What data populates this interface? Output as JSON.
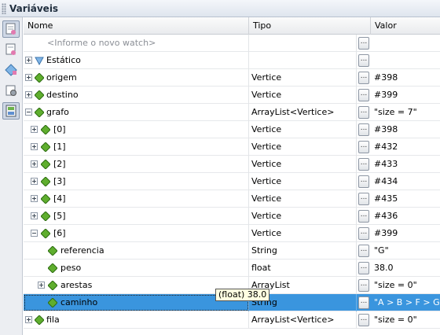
{
  "panel": {
    "title": "Variáveis"
  },
  "toolbar": {
    "buttons": [
      {
        "icon": "watch-icon",
        "pressed": true
      },
      {
        "icon": "watch-add-icon",
        "pressed": false
      },
      {
        "icon": "add-watch-icon",
        "pressed": false
      },
      {
        "icon": "settings-icon",
        "pressed": false
      },
      {
        "icon": "variables-view-icon",
        "pressed": true
      }
    ]
  },
  "columns": {
    "name": "Nome",
    "type": "Tipo",
    "value": "Valor"
  },
  "rows": [
    {
      "name": "<Informe o novo watch>",
      "type": "",
      "value": "",
      "placeholder": true
    },
    {
      "name": "Estático",
      "type": "",
      "value": ""
    },
    {
      "name": "origem",
      "type": "Vertice",
      "value": "#398"
    },
    {
      "name": "destino",
      "type": "Vertice",
      "value": "#399"
    },
    {
      "name": "grafo",
      "type": "ArrayList<Vertice>",
      "value": "\"size = 7\""
    },
    {
      "name": "[0]",
      "type": "Vertice",
      "value": "#398"
    },
    {
      "name": "[1]",
      "type": "Vertice",
      "value": "#432"
    },
    {
      "name": "[2]",
      "type": "Vertice",
      "value": "#433"
    },
    {
      "name": "[3]",
      "type": "Vertice",
      "value": "#434"
    },
    {
      "name": "[4]",
      "type": "Vertice",
      "value": "#435"
    },
    {
      "name": "[5]",
      "type": "Vertice",
      "value": "#436"
    },
    {
      "name": "[6]",
      "type": "Vertice",
      "value": "#399"
    },
    {
      "name": "referencia",
      "type": "String",
      "value": "\"G\""
    },
    {
      "name": "peso",
      "type": "float",
      "value": "38.0"
    },
    {
      "name": "arestas",
      "type": "ArrayList",
      "value": "\"size = 0\""
    },
    {
      "name": "caminho",
      "type": "String",
      "value": "\"A > B > F > G\"",
      "selected": true
    },
    {
      "name": "fila",
      "type": "ArrayList<Vertice>",
      "value": "\"size = 0\""
    }
  ],
  "tooltip": {
    "text": "(float) 38.0"
  },
  "colors": {
    "selection": "#3a95de",
    "diamond": "#5fae2e",
    "static_icon": "#7fb4e6"
  }
}
